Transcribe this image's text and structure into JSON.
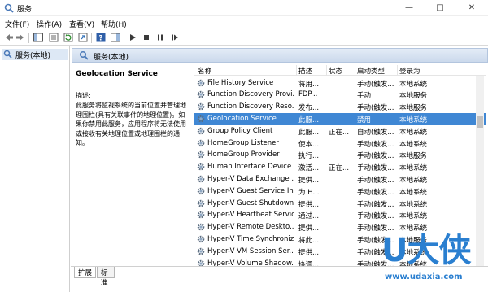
{
  "window": {
    "title": "服务"
  },
  "menu": [
    "文件(F)",
    "操作(A)",
    "查看(V)",
    "帮助(H)"
  ],
  "tree": {
    "item": "服务(本地)"
  },
  "pane": {
    "header": "服务(本地)"
  },
  "description": {
    "service_name": "Geolocation Service",
    "label": "描述:",
    "text": "此服务将监视系统的当前位置并管理地理围栏(具有关联事件的地理位置)。如果你禁用此服务，应用程序将无法使用或接收有关地理位置或地理围栏的通知。"
  },
  "table": {
    "headers": [
      "名称",
      "描述",
      "状态",
      "启动类型",
      "登录为"
    ],
    "rows": [
      {
        "name": "File History Service",
        "desc": "将用...",
        "status": "",
        "startup": "手动(触发...",
        "logon": "本地系统"
      },
      {
        "name": "Function Discovery Provi...",
        "desc": "FDP...",
        "status": "",
        "startup": "手动",
        "logon": "本地服务"
      },
      {
        "name": "Function Discovery Reso...",
        "desc": "发布...",
        "status": "",
        "startup": "手动(触发...",
        "logon": "本地服务"
      },
      {
        "name": "Geolocation Service",
        "desc": "此服...",
        "status": "",
        "startup": "禁用",
        "logon": "本地系统"
      },
      {
        "name": "Group Policy Client",
        "desc": "此服...",
        "status": "正在...",
        "startup": "自动(触发...",
        "logon": "本地系统"
      },
      {
        "name": "HomeGroup Listener",
        "desc": "使本...",
        "status": "",
        "startup": "手动(触发...",
        "logon": "本地系统"
      },
      {
        "name": "HomeGroup Provider",
        "desc": "执行...",
        "status": "",
        "startup": "手动(触发...",
        "logon": "本地服务"
      },
      {
        "name": "Human Interface Device ...",
        "desc": "激活...",
        "status": "正在...",
        "startup": "手动(触发...",
        "logon": "本地系统"
      },
      {
        "name": "Hyper-V Data Exchange ...",
        "desc": "提供...",
        "status": "",
        "startup": "手动(触发...",
        "logon": "本地系统"
      },
      {
        "name": "Hyper-V Guest Service In...",
        "desc": "为 H...",
        "status": "",
        "startup": "手动(触发...",
        "logon": "本地系统"
      },
      {
        "name": "Hyper-V Guest Shutdown...",
        "desc": "提供...",
        "status": "",
        "startup": "手动(触发...",
        "logon": "本地系统"
      },
      {
        "name": "Hyper-V Heartbeat Service",
        "desc": "通过...",
        "status": "",
        "startup": "手动(触发...",
        "logon": "本地系统"
      },
      {
        "name": "Hyper-V Remote Deskto...",
        "desc": "提供...",
        "status": "",
        "startup": "手动(触发...",
        "logon": "本地系统"
      },
      {
        "name": "Hyper-V Time Synchroniz...",
        "desc": "将此...",
        "status": "",
        "startup": "手动(触发...",
        "logon": "本地服务"
      },
      {
        "name": "Hyper-V VM Session Ser...",
        "desc": "提供...",
        "status": "",
        "startup": "手动(触发...",
        "logon": "本地系统"
      },
      {
        "name": "Hyper-V Volume Shadow...",
        "desc": "协调...",
        "status": "",
        "startup": "手动(触发...",
        "logon": "本地系统"
      }
    ],
    "selected_index": 3
  },
  "tabs": [
    "扩展",
    "标准"
  ],
  "watermark": {
    "logo": "U大侠",
    "url": "www.udaxia.com"
  },
  "colors": {
    "selection": "#3f87d4",
    "watermark": "#2a7fd0",
    "pane_header": "#cbd9ec"
  },
  "icons": {
    "toolbar": [
      "back-icon",
      "forward-icon",
      "console-tree-icon",
      "properties-icon",
      "refresh-icon",
      "export-icon",
      "help-icon",
      "action-pane-icon",
      "play-icon",
      "stop-icon",
      "pause-icon",
      "restart-icon"
    ]
  }
}
